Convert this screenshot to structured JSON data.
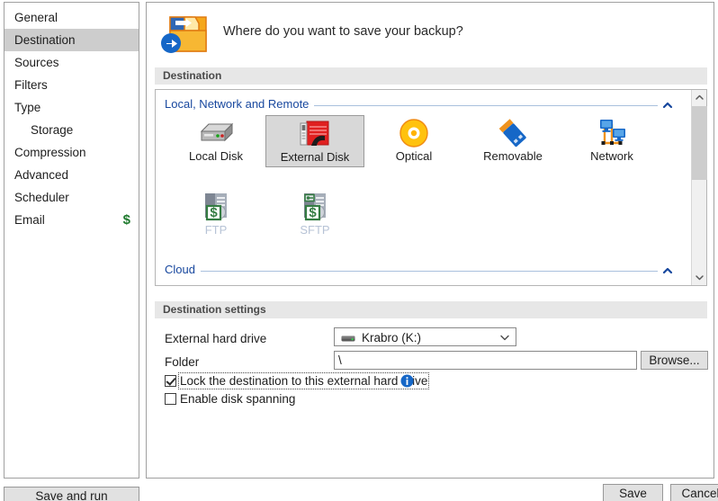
{
  "sidebar": {
    "items": [
      {
        "label": "General",
        "selected": false,
        "sub": false,
        "badge": ""
      },
      {
        "label": "Destination",
        "selected": true,
        "sub": false,
        "badge": ""
      },
      {
        "label": "Sources",
        "selected": false,
        "sub": false,
        "badge": ""
      },
      {
        "label": "Filters",
        "selected": false,
        "sub": false,
        "badge": ""
      },
      {
        "label": "Type",
        "selected": false,
        "sub": false,
        "badge": ""
      },
      {
        "label": "Storage",
        "selected": false,
        "sub": true,
        "badge": ""
      },
      {
        "label": "Compression",
        "selected": false,
        "sub": false,
        "badge": ""
      },
      {
        "label": "Advanced",
        "selected": false,
        "sub": false,
        "badge": ""
      },
      {
        "label": "Scheduler",
        "selected": false,
        "sub": false,
        "badge": ""
      },
      {
        "label": "Email",
        "selected": false,
        "sub": false,
        "badge": "$"
      }
    ]
  },
  "banner": {
    "title": "Where do you want to save your backup?",
    "icon": "folder-export-icon"
  },
  "groups": {
    "destination": "Destination",
    "destination_settings": "Destination settings"
  },
  "destination": {
    "sections": [
      {
        "label": "Local, Network and Remote",
        "chevron": "chevron-up-icon"
      },
      {
        "label": "Cloud",
        "chevron": "chevron-up-icon"
      }
    ],
    "tiles": [
      {
        "label": "Local Disk",
        "icon": "local-disk-icon",
        "selected": false,
        "disabled": false
      },
      {
        "label": "External Disk",
        "icon": "external-disk-icon",
        "selected": true,
        "disabled": false
      },
      {
        "label": "Optical",
        "icon": "optical-disc-icon",
        "selected": false,
        "disabled": false
      },
      {
        "label": "Removable",
        "icon": "usb-drive-icon",
        "selected": false,
        "disabled": false
      },
      {
        "label": "Network",
        "icon": "network-icon",
        "selected": false,
        "disabled": false
      },
      {
        "label": "FTP",
        "icon": "ftp-server-icon",
        "selected": false,
        "disabled": true
      },
      {
        "label": "SFTP",
        "icon": "sftp-server-icon",
        "selected": false,
        "disabled": true
      }
    ],
    "scrollbar": {
      "up_icon": "scroll-up-icon",
      "down_icon": "scroll-down-icon"
    }
  },
  "settings": {
    "drive_label": "External hard drive",
    "drive_value": "Krabro (K:)",
    "drive_icon": "hard-drive-icon",
    "drive_arrow": "chevron-down-icon",
    "folder_label": "Folder",
    "folder_value": "\\",
    "folder_placeholder": "",
    "browse_label": "Browse...",
    "lock_checkbox": {
      "label": "Lock the destination to this external hard drive",
      "checked": true,
      "focused": true
    },
    "spanning_checkbox": {
      "label": "Enable disk spanning",
      "checked": false,
      "focused": false
    },
    "info_icon": "info-icon"
  },
  "footer": {
    "save_and_run": "Save and run",
    "save": "Save",
    "cancel": "Cancel"
  },
  "colors": {
    "accent_blue": "#17479e",
    "selection_gray": "#cdcdcd",
    "group_bar": "#e7e7e7",
    "badge_green": "#1f7a2e",
    "disabled_label": "#b7c3d6"
  }
}
